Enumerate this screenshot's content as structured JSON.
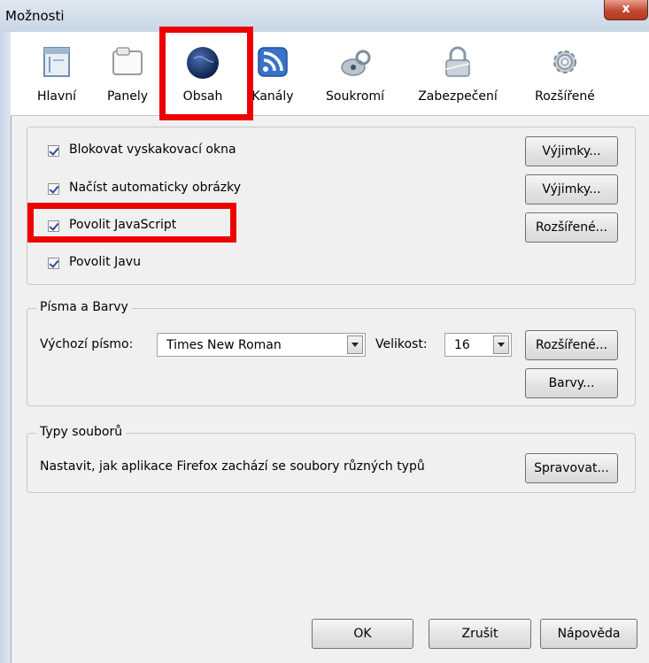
{
  "window": {
    "title": "Možnosti",
    "close_glyph": "x"
  },
  "toolbar": {
    "items": [
      {
        "label": "Hlavní",
        "icon": "general-window-icon"
      },
      {
        "label": "Panely",
        "icon": "tabs-window-icon"
      },
      {
        "label": "Obsah",
        "icon": "globe-icon"
      },
      {
        "label": "Kanály",
        "icon": "rss-icon"
      },
      {
        "label": "Soukromí",
        "icon": "privacy-mask-icon"
      },
      {
        "label": "Zabezpečení",
        "icon": "padlock-icon"
      },
      {
        "label": "Rozšířené",
        "icon": "gear-icon"
      }
    ],
    "selected": "Obsah"
  },
  "content": {
    "checkboxes": [
      {
        "label": "Blokovat vyskakovací okna",
        "checked": true,
        "button": "Výjimky..."
      },
      {
        "label": "Načíst automaticky obrázky",
        "checked": true,
        "button": "Výjimky..."
      },
      {
        "label": "Povolit JavaScript",
        "checked": true,
        "button": "Rozšířené..."
      },
      {
        "label": "Povolit Javu",
        "checked": true
      }
    ]
  },
  "fonts": {
    "legend": "Písma a Barvy",
    "default_font_label": "Výchozí písmo:",
    "default_font_value": "Times New Roman",
    "size_label": "Velikost:",
    "size_value": "16",
    "advanced_button": "Rozšířené...",
    "colors_button": "Barvy..."
  },
  "filetypes": {
    "legend": "Typy souborů",
    "description": "Nastavit, jak aplikace Firefox zachází se soubory různých typů",
    "manage_button": "Spravovat..."
  },
  "footer": {
    "ok": "OK",
    "cancel": "Zrušit",
    "help": "Nápověda"
  },
  "colors": {
    "highlight": "#ee0000",
    "title_bar": "#c8d6e5"
  }
}
